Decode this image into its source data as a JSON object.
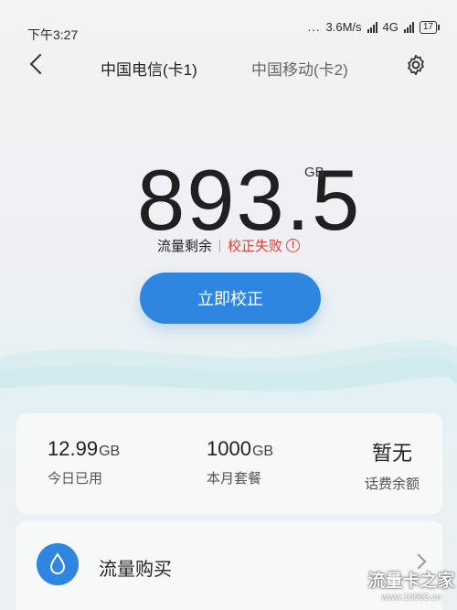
{
  "status_bar": {
    "time": "下午3:27",
    "dots": "...",
    "speed": "3.6M/s",
    "network": "4G",
    "battery": "17"
  },
  "nav": {
    "back_icon": "back-arrow-icon",
    "tabs": [
      {
        "label": "中国电信(卡1)",
        "active": true
      },
      {
        "label": "中国移动(卡2)",
        "active": false
      }
    ],
    "settings_icon": "gear-icon"
  },
  "hero": {
    "value": "893.5",
    "unit": "GB",
    "remain_label": "流量剩余",
    "status_text": "校正失败",
    "status_icon": "alert-circle-icon",
    "status_color": "#d9433a"
  },
  "correct_button": {
    "label": "立即校正",
    "color": "#2f86e0"
  },
  "stats": [
    {
      "value": "12.99",
      "unit": "GB",
      "label": "今日已用"
    },
    {
      "value": "1000",
      "unit": "GB",
      "label": "本月套餐"
    },
    {
      "value": "暂无",
      "unit": "",
      "label": "话费余额"
    }
  ],
  "buy": {
    "label": "流量购买",
    "icon": "water-drop-icon"
  },
  "watermark": {
    "title": "流量卡之家",
    "url": "www.10063.cn"
  }
}
